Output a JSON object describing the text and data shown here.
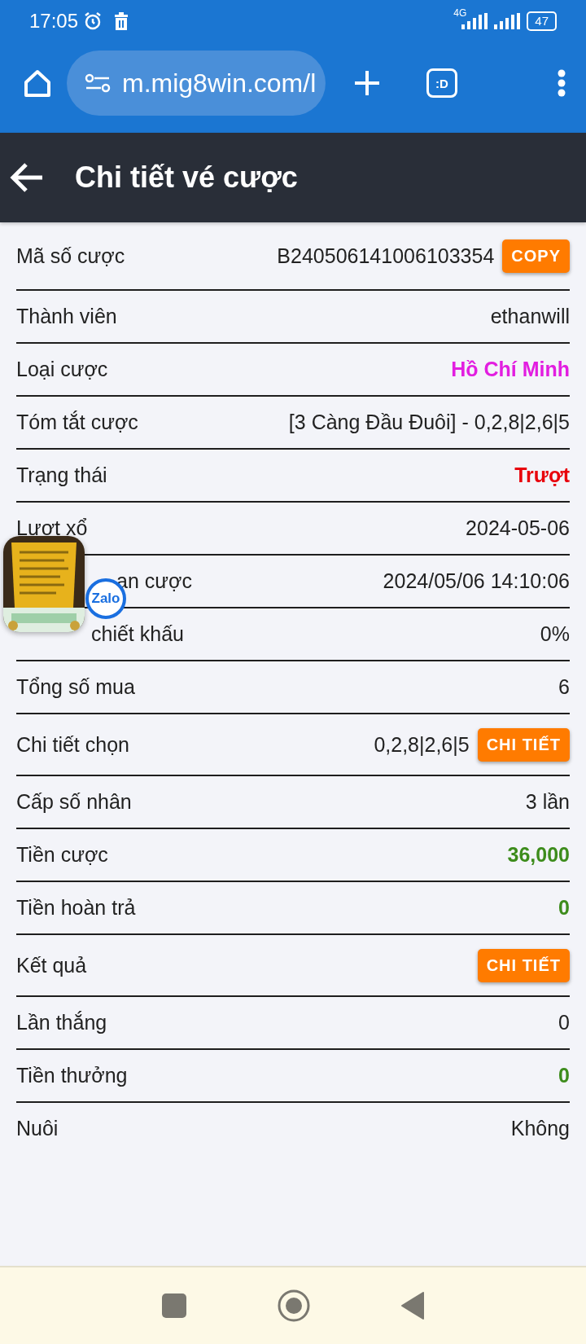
{
  "status_bar": {
    "time": "17:05",
    "network": "4G",
    "battery": "47"
  },
  "browser": {
    "url": "m.mig8win.com/l",
    "tab_switcher": ":D"
  },
  "header": {
    "title": "Chi tiết vé cược"
  },
  "rows": [
    {
      "label": "Mã số cược",
      "value": "B240506141006103354",
      "button": "COPY"
    },
    {
      "label": "Thành viên",
      "value": "ethanwill"
    },
    {
      "label": "Loại cược",
      "value": "Hồ Chí Minh",
      "color": "#e21ee0"
    },
    {
      "label": "Tóm tắt cược",
      "value": "[3 Càng Đầu Đuôi] - 0,2,8|2,6|5"
    },
    {
      "label": "Trạng thái",
      "value": "Trượt",
      "color": "#e8000b"
    },
    {
      "label": "Lượt xổ",
      "value": "2024-05-06"
    },
    {
      "label": "an cược",
      "value": "2024/05/06 14:10:06",
      "obscured": true
    },
    {
      "label": "chiết khấu",
      "value": "0%",
      "obscured": true
    },
    {
      "label": "Tổng số mua",
      "value": "6"
    },
    {
      "label": "Chi tiết chọn",
      "value": "0,2,8|2,6|5",
      "button": "CHI TIẾT"
    },
    {
      "label": "Cấp số nhân",
      "value": "3 lần"
    },
    {
      "label": "Tiền cược",
      "value": "36,000",
      "color": "#3d8c1c"
    },
    {
      "label": "Tiền hoàn trả",
      "value": "0",
      "color": "#3d8c1c"
    },
    {
      "label": "Kết quả",
      "button": "CHI TIẾT"
    },
    {
      "label": "Lần thắng",
      "value": "0"
    },
    {
      "label": "Tiền thưởng",
      "value": "0",
      "color": "#3d8c1c"
    },
    {
      "label": "Nuôi",
      "value": "Không"
    }
  ],
  "chat_head": {
    "kind": "picture",
    "badge": "Zalo"
  }
}
